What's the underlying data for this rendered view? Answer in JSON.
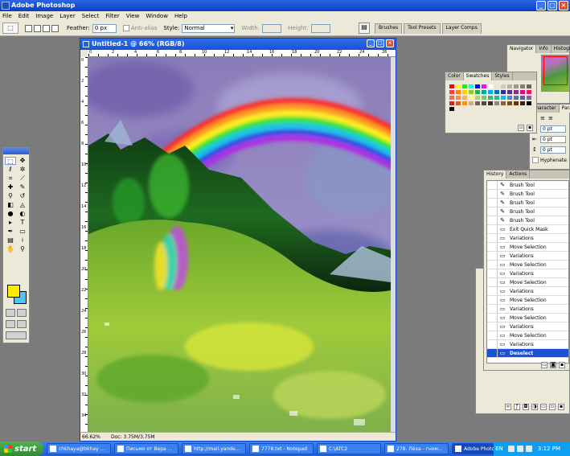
{
  "app": {
    "title": "Adobe Photoshop"
  },
  "window_buttons": {
    "minimize": "_",
    "maximize": "□",
    "close": "×"
  },
  "menu": [
    "File",
    "Edit",
    "Image",
    "Layer",
    "Select",
    "Filter",
    "View",
    "Window",
    "Help"
  ],
  "options_bar": {
    "feather_label": "Feather:",
    "feather_value": "0 px",
    "antialias_label": "Anti-alias",
    "style_label": "Style:",
    "style_value": "Normal",
    "width_label": "Width:",
    "height_label": "Height:",
    "well_tabs": [
      "Brushes",
      "Tool Presets",
      "Layer Comps"
    ]
  },
  "document": {
    "title": "Untitled-1 @ 66% (RGB/8)",
    "zoom": "66.62%",
    "doc_info": "Doc: 3.75M/3.75M",
    "ruler_h": [
      "0",
      "2",
      "4",
      "6",
      "8",
      "10",
      "12",
      "14",
      "16",
      "18",
      "20",
      "22",
      "24",
      "26"
    ],
    "ruler_v": [
      "0",
      "2",
      "4",
      "6",
      "8",
      "10",
      "12",
      "14",
      "16",
      "18",
      "20",
      "22",
      "24",
      "26",
      "28",
      "30",
      "32",
      "34"
    ]
  },
  "navigator": {
    "tabs": [
      "Navigator",
      "Info",
      "Histogram"
    ]
  },
  "swatches": {
    "tabs": [
      "Color",
      "Swatches",
      "Styles"
    ],
    "colors": [
      "#ff0000",
      "#ffff00",
      "#00ff00",
      "#00ffff",
      "#0000ff",
      "#ff00ff",
      "#ffffff",
      "#e5e5e5",
      "#cccccc",
      "#b2b2b2",
      "#999999",
      "#7f7f7f",
      "#666666",
      "#ff3c3c",
      "#ff7f00",
      "#ffd100",
      "#8ccf2a",
      "#22b14c",
      "#00a99d",
      "#00aeef",
      "#0072bc",
      "#2e3192",
      "#662d91",
      "#92278f",
      "#ec008c",
      "#ed145b",
      "#f26c4f",
      "#f68e56",
      "#fbaf5d",
      "#fff799",
      "#acd373",
      "#7cc576",
      "#3cb878",
      "#1cbbb4",
      "#00bff3",
      "#448ccb",
      "#5674b9",
      "#605ca8",
      "#855fa8",
      "#c1272d",
      "#d35f1d",
      "#f7941d",
      "#c7b299",
      "#736357",
      "#534741",
      "#362f2d",
      "#998675",
      "#8c6239",
      "#754c24",
      "#603913",
      "#3c2415",
      "#000000",
      "#111111"
    ]
  },
  "character": {
    "tabs": [
      "Character",
      "Paragraph"
    ],
    "indent1": "0 pt",
    "indent2": "0 pt",
    "space": "0 pt",
    "hyphenate": "Hyphenate"
  },
  "history": {
    "tabs": [
      "History",
      "Actions"
    ],
    "items": [
      "Brush Tool",
      "Brush Tool",
      "Brush Tool",
      "Brush Tool",
      "Brush Tool",
      "Exit Quick Mask",
      "Variations",
      "Move Selection",
      "Variations",
      "Move Selection",
      "Variations",
      "Move Selection",
      "Variations",
      "Move Selection",
      "Variations",
      "Move Selection",
      "Variations",
      "Move Selection",
      "Variations",
      "Deselect"
    ],
    "selected": "Deselect"
  },
  "taskbar": {
    "start": "start",
    "items": [
      "chkhaya@bkhay ...",
      "Письмо от Вера ...",
      "http://mail.yande...",
      "7778.txt - Notepad",
      "C:\\ATC2",
      "278. Лёха - гном...",
      "Adobe Photoshop"
    ],
    "active": "Adobe Photoshop",
    "lang": "EN",
    "clock": "3:12 PM"
  },
  "colors": {
    "title_blue": "#0a3fc4",
    "taskbar_blue": "#1f5fd8",
    "start_green": "#2f8a2f",
    "panel_bg": "#ece9d8",
    "foreground": "#ffea00",
    "background": "#4fc3f7"
  }
}
